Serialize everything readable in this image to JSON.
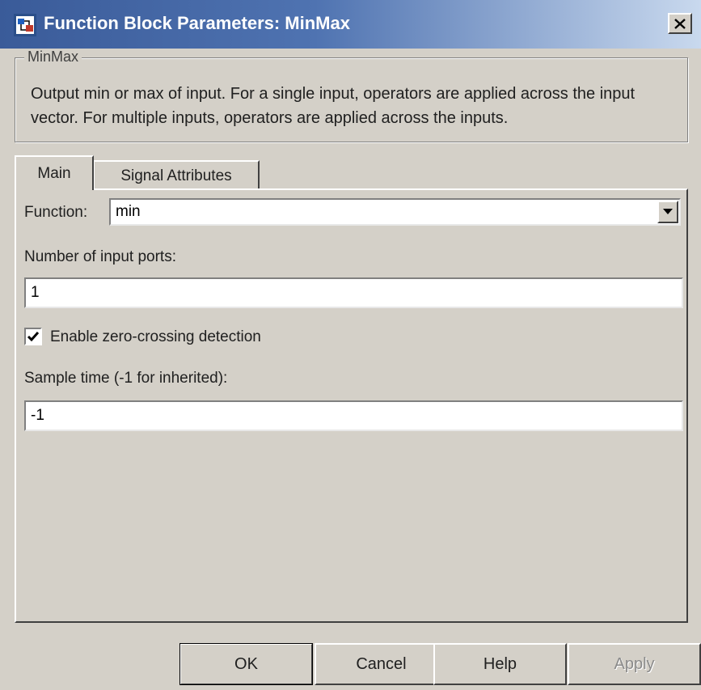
{
  "window": {
    "title": "Function Block Parameters: MinMax",
    "close_label": "✕"
  },
  "group": {
    "legend": "MinMax",
    "description": "Output min or max of input.  For a single input, operators are applied across the input vector.  For multiple inputs, operators are applied across the inputs."
  },
  "tabs": [
    {
      "label": "Main",
      "selected": true
    },
    {
      "label": "Signal Attributes",
      "selected": false
    }
  ],
  "main": {
    "function_label": "Function:",
    "function_value": "min",
    "num_inputs_label": "Number of input ports:",
    "num_inputs_value": "1",
    "zero_crossing_label": "Enable zero-crossing detection",
    "zero_crossing_checked": true,
    "sample_time_label": "Sample time (-1 for inherited):",
    "sample_time_value": "-1"
  },
  "buttons": {
    "ok": "OK",
    "cancel": "Cancel",
    "help": "Help",
    "apply": "Apply"
  },
  "colors": {
    "face": "#d4d0c8",
    "title_text": "#ffffff",
    "disabled_text": "#8a8a8a"
  }
}
